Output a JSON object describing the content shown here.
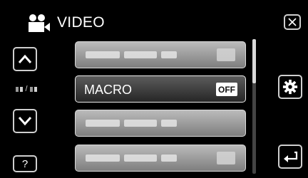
{
  "header": {
    "title": "VIDEO",
    "icon": "video-camera-icon"
  },
  "controls": {
    "close_icon": "close-icon",
    "up_icon": "chevron-up-icon",
    "down_icon": "chevron-down-icon",
    "help_label": "?",
    "gear_icon": "gear-icon",
    "back_icon": "back-icon",
    "page_separator": "/"
  },
  "menu": {
    "items": [
      {
        "label": "",
        "value": "",
        "blurred": true
      },
      {
        "label": "MACRO",
        "value": "OFF",
        "blurred": false,
        "selected": true
      },
      {
        "label": "",
        "value": "",
        "blurred": true
      },
      {
        "label": "",
        "value": "",
        "blurred": true
      }
    ]
  },
  "colors": {
    "background": "#000000",
    "item_bg": "#a0a0a0",
    "item_selected_bg": "#3a3a3a",
    "border": "#cfcfcf"
  }
}
